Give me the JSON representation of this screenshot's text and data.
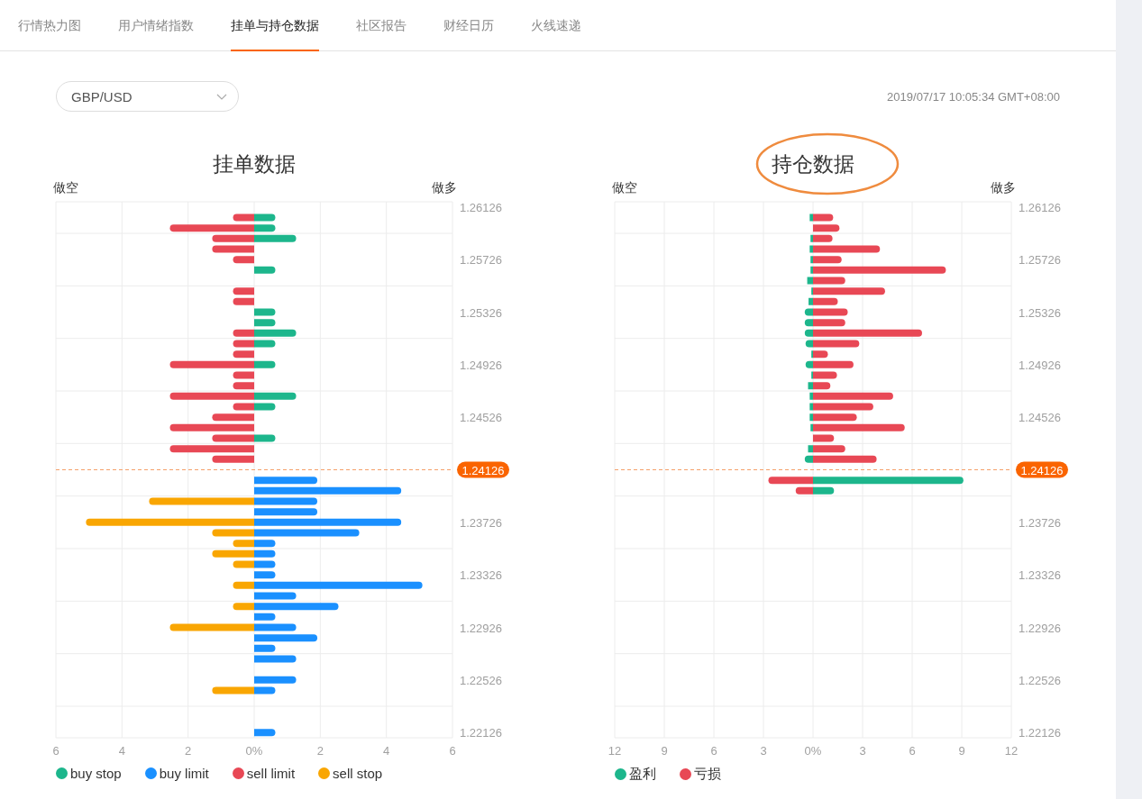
{
  "tabs": [
    {
      "label": "行情热力图",
      "selected": false
    },
    {
      "label": "用户情绪指数",
      "selected": false
    },
    {
      "label": "挂单与持仓数据",
      "selected": true
    },
    {
      "label": "社区报告",
      "selected": false
    },
    {
      "label": "财经日历",
      "selected": false
    },
    {
      "label": "火线速递",
      "selected": false
    }
  ],
  "symbol_select": {
    "value": "GBP/USD"
  },
  "timestamp": "2019/07/17 10:05:34 GMT+08:00",
  "panels": [
    {
      "title": "挂单数据",
      "title_circled": false,
      "short_label": "做空",
      "long_label": "做多",
      "chart_data": {
        "type": "bar",
        "orientation": "horizontal",
        "stacked": true,
        "grid": true,
        "categories": [
          "1.26126",
          null,
          null,
          null,
          null,
          "1.25726",
          null,
          null,
          null,
          null,
          "1.25326",
          null,
          null,
          null,
          null,
          "1.24926",
          null,
          null,
          null,
          null,
          "1.24526",
          null,
          null,
          null,
          null,
          "1.24126",
          null,
          null,
          null,
          null,
          "1.23726",
          null,
          null,
          null,
          null,
          "1.23326",
          null,
          null,
          null,
          null,
          "1.22926",
          null,
          null,
          null,
          null,
          "1.22526",
          null,
          null,
          null,
          null,
          "1.22126"
        ],
        "xlim": [
          -6,
          6
        ],
        "xticks": [
          {
            "value": -6,
            "label": "6"
          },
          {
            "value": -4,
            "label": "4"
          },
          {
            "value": -2,
            "label": "2"
          },
          {
            "value": 0,
            "label": "0%"
          },
          {
            "value": 2,
            "label": "2"
          },
          {
            "value": 4,
            "label": "4"
          },
          {
            "value": 6,
            "label": "6"
          }
        ],
        "ref_lines": [
          {
            "axis": "y",
            "value": "1.24126"
          }
        ],
        "series": [
          {
            "name": "buy stop",
            "color": "#1db68c",
            "values": [
              null,
              0.64,
              0.64,
              1.27,
              null,
              null,
              0.64,
              null,
              null,
              null,
              0.64,
              0.64,
              1.27,
              0.64,
              null,
              0.64,
              null,
              null,
              1.27,
              0.64,
              null,
              null,
              0.64,
              null,
              null,
              null,
              null,
              null,
              null,
              null,
              null,
              null,
              null,
              null,
              null,
              null,
              null,
              null,
              null,
              null,
              null,
              null,
              null,
              null,
              null,
              null,
              null,
              null,
              null,
              null,
              null
            ]
          },
          {
            "name": "buy limit",
            "color": "#1a90ff",
            "values": [
              null,
              null,
              null,
              null,
              null,
              null,
              null,
              null,
              null,
              null,
              null,
              null,
              null,
              null,
              null,
              null,
              null,
              null,
              null,
              null,
              null,
              null,
              null,
              null,
              null,
              null,
              1.91,
              4.45,
              1.91,
              1.91,
              4.45,
              3.18,
              0.64,
              0.64,
              0.64,
              0.64,
              5.09,
              1.27,
              2.55,
              0.64,
              1.27,
              1.91,
              0.64,
              1.27,
              null,
              1.27,
              0.64,
              null,
              null,
              null,
              0.64
            ]
          },
          {
            "name": "sell limit",
            "color": "#e84855",
            "values": [
              null,
              -0.64,
              -2.55,
              -1.27,
              -1.27,
              -0.64,
              null,
              null,
              -0.64,
              -0.64,
              null,
              null,
              -0.64,
              -0.64,
              -0.64,
              -2.55,
              -0.64,
              -0.64,
              -2.55,
              -0.64,
              -1.27,
              -2.55,
              -1.27,
              -2.55,
              -1.27,
              null,
              null,
              null,
              null,
              null,
              null,
              null,
              null,
              null,
              null,
              null,
              null,
              null,
              null,
              null,
              null,
              null,
              null,
              null,
              null,
              null,
              null,
              null,
              null,
              null,
              null
            ]
          },
          {
            "name": "sell stop",
            "color": "#f9a602",
            "values": [
              null,
              null,
              null,
              null,
              null,
              null,
              null,
              null,
              null,
              null,
              null,
              null,
              null,
              null,
              null,
              null,
              null,
              null,
              null,
              null,
              null,
              null,
              null,
              null,
              null,
              null,
              null,
              null,
              -3.18,
              null,
              -5.09,
              -1.27,
              -0.64,
              -1.27,
              -0.64,
              null,
              -0.64,
              null,
              -0.64,
              null,
              -2.55,
              null,
              null,
              null,
              null,
              null,
              -1.27,
              null,
              null,
              null,
              null
            ]
          }
        ]
      }
    },
    {
      "title": "持仓数据",
      "title_circled": true,
      "short_label": "做空",
      "long_label": "做多",
      "chart_data": {
        "type": "bar",
        "orientation": "horizontal",
        "stacked": true,
        "grid": true,
        "categories": [
          "1.26126",
          null,
          null,
          null,
          null,
          "1.25726",
          null,
          null,
          null,
          null,
          "1.25326",
          null,
          null,
          null,
          null,
          "1.24926",
          null,
          null,
          null,
          null,
          "1.24526",
          null,
          null,
          null,
          null,
          "1.24126",
          null,
          null,
          null,
          null,
          "1.23726",
          null,
          null,
          null,
          null,
          "1.23326",
          null,
          null,
          null,
          null,
          "1.22926",
          null,
          null,
          null,
          null,
          "1.22526",
          null,
          null,
          null,
          null,
          "1.22126"
        ],
        "xlim": [
          -12,
          12
        ],
        "xticks": [
          {
            "value": -12,
            "label": "12"
          },
          {
            "value": -9,
            "label": "9"
          },
          {
            "value": -6,
            "label": "6"
          },
          {
            "value": -3,
            "label": "3"
          },
          {
            "value": 0,
            "label": "0%"
          },
          {
            "value": 3,
            "label": "3"
          },
          {
            "value": 6,
            "label": "6"
          },
          {
            "value": 9,
            "label": "9"
          },
          {
            "value": 12,
            "label": "12"
          }
        ],
        "ref_lines": [
          {
            "axis": "y",
            "value": "1.24126"
          }
        ],
        "series": [
          {
            "name": "盈利",
            "color": "#1db68c",
            "values": [
              null,
              -0.2,
              null,
              -0.15,
              -0.2,
              -0.15,
              -0.15,
              -0.35,
              -0.1,
              -0.27,
              -0.5,
              -0.5,
              -0.5,
              -0.45,
              -0.1,
              -0.45,
              -0.1,
              -0.3,
              -0.2,
              -0.2,
              -0.2,
              -0.15,
              null,
              -0.3,
              -0.5,
              null,
              9.1,
              1.27,
              null,
              null,
              null,
              null,
              null,
              null,
              null,
              null,
              null,
              null,
              null,
              null,
              null,
              null,
              null,
              null,
              null,
              null,
              null,
              null,
              null,
              null,
              null
            ]
          },
          {
            "name": "亏损",
            "color": "#e84855",
            "values": [
              null,
              1.22,
              1.6,
              1.18,
              4.05,
              1.73,
              8.04,
              1.95,
              4.36,
              1.5,
              2.1,
              1.95,
              6.6,
              2.8,
              0.9,
              2.45,
              1.45,
              1.05,
              4.85,
              3.65,
              2.65,
              5.55,
              1.27,
              1.95,
              3.85,
              null,
              -2.7,
              -1.05,
              null,
              null,
              null,
              null,
              null,
              null,
              null,
              null,
              null,
              null,
              null,
              null,
              null,
              null,
              null,
              null,
              null,
              null,
              null,
              null,
              null,
              null,
              null
            ]
          }
        ]
      }
    }
  ]
}
